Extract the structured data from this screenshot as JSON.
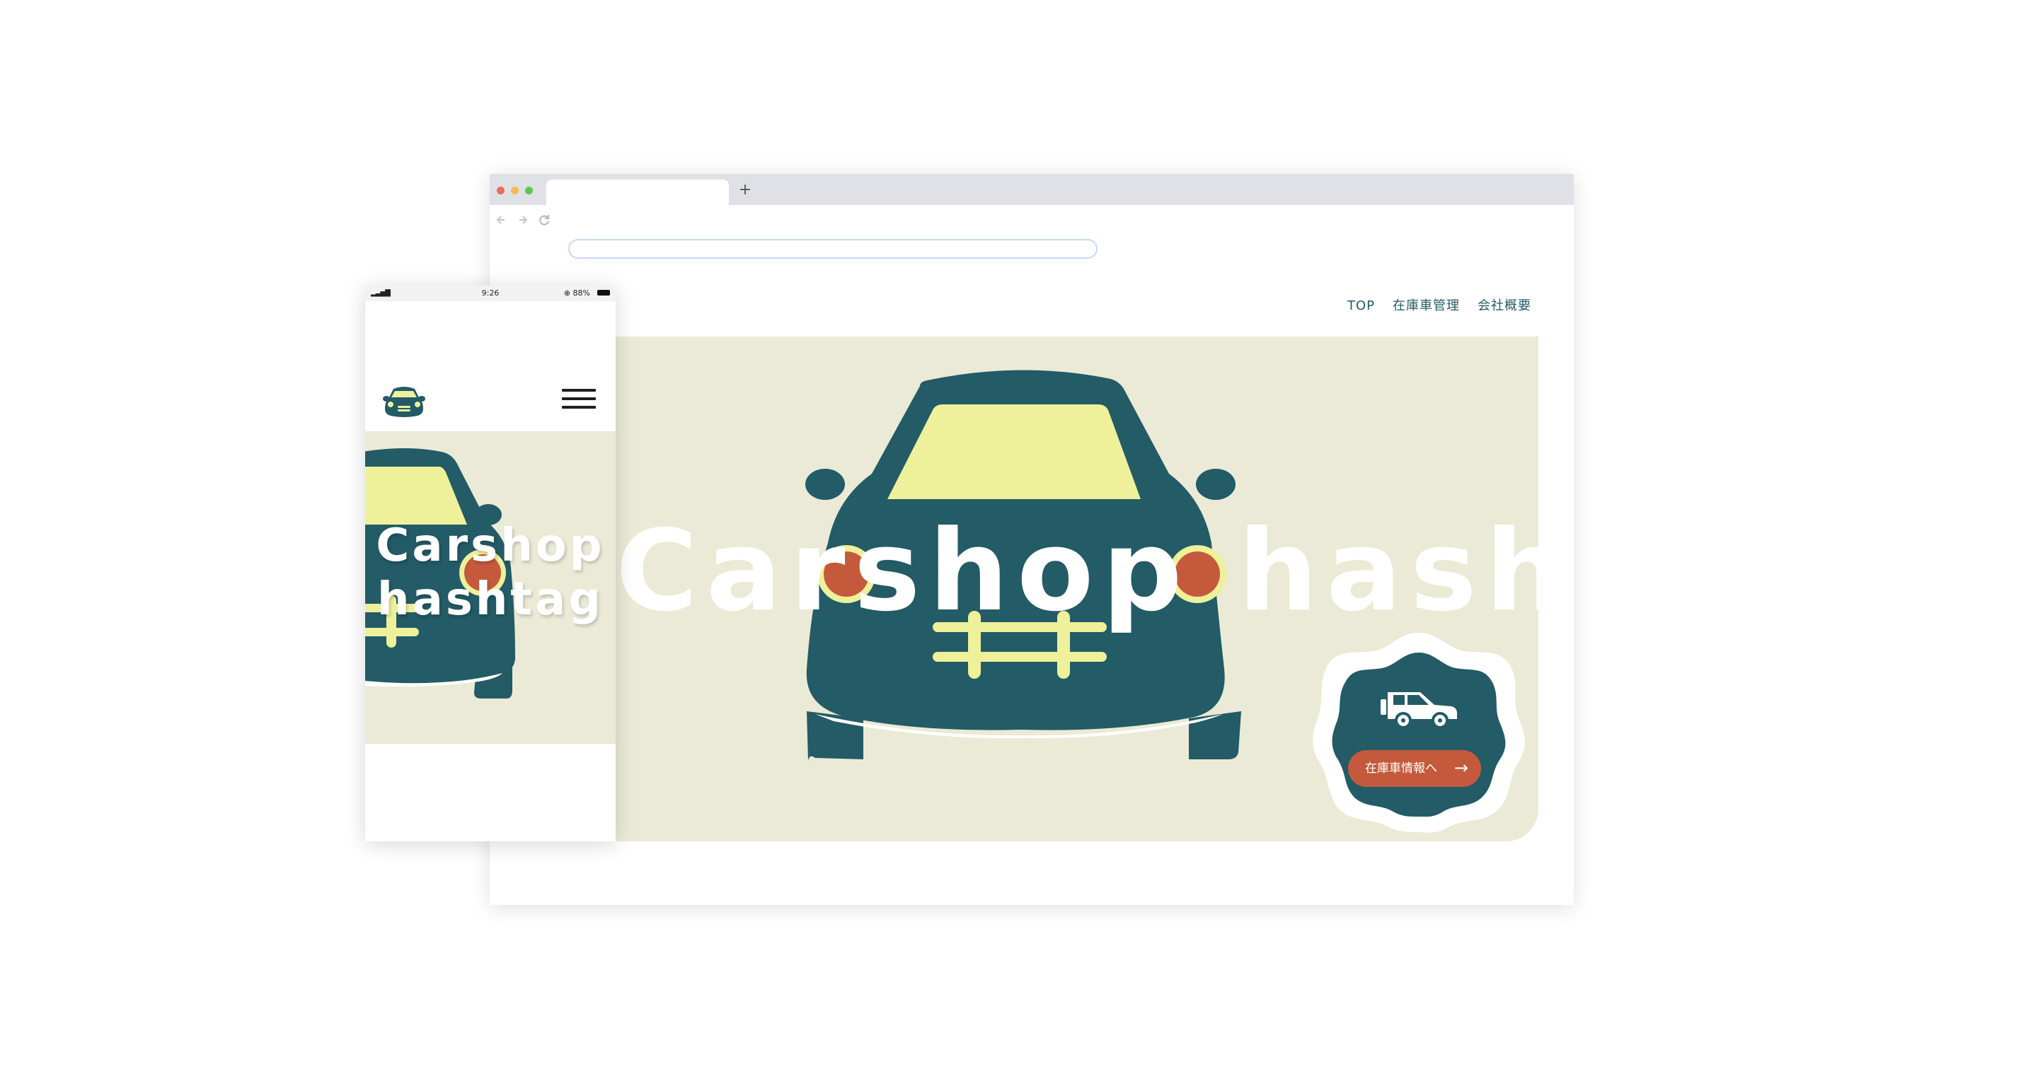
{
  "colors": {
    "teal": "#235b66",
    "cream": "#ebead6",
    "yellow": "#eef09a",
    "red_accent": "#c45a3b",
    "white": "#ffffff"
  },
  "browser": {
    "icons": {
      "back": "arrow-left-icon",
      "forward": "arrow-right-icon",
      "reload": "reload-icon",
      "new_tab": "plus-icon"
    },
    "new_tab_glyph": "+"
  },
  "site": {
    "nav": {
      "top": "TOP",
      "inventory_mgmt": "在庫車管理",
      "company": "会社概要"
    },
    "hero_title": "Carshop hashtag",
    "cta": {
      "label": "在庫車情報へ",
      "arrow": "→"
    },
    "icons": {
      "badge_car": "suv-car-icon",
      "hero_car": "car-front-illustration"
    }
  },
  "mobile": {
    "status": {
      "signal": "▂▃▅▇",
      "time": "9:26",
      "battery": "⊕ 88%"
    },
    "hero_title_line1": "Carshop",
    "hero_title_line2": "hashtag",
    "icons": {
      "logo": "car-logo-icon",
      "menu": "hamburger-menu-icon"
    }
  }
}
